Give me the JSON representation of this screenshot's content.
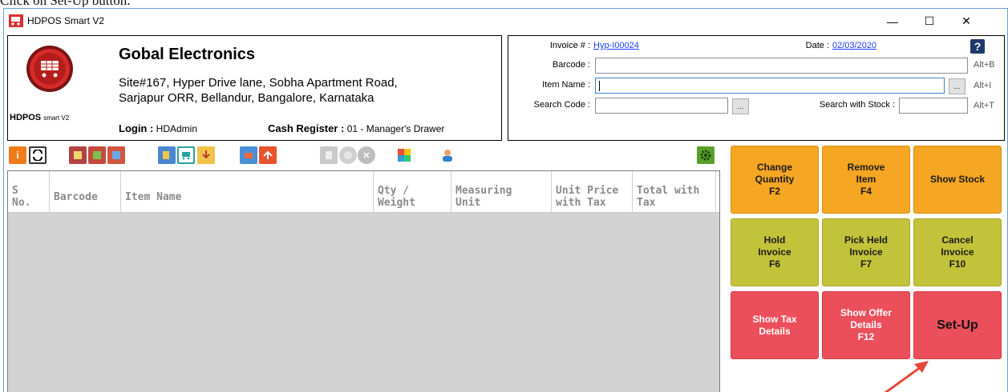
{
  "document": {
    "caption": "Click on Set-Up button."
  },
  "window": {
    "title": "HDPOS Smart V2",
    "minimize_glyph": "—",
    "maximize_glyph": "☐",
    "close_glyph": "✕"
  },
  "store": {
    "name": "Gobal Electronics",
    "address_line1": "Site#167, Hyper Drive lane, Sobha Apartment Road,",
    "address_line2": "Sarjapur ORR, Bellandur, Bangalore, Karnataka",
    "logo_caption": "HDPOS",
    "logo_caption_small": "smart V2",
    "login_label": "Login :",
    "login_value": "HDAdmin",
    "cash_label": "Cash Register :",
    "cash_value": "01 - Manager's Drawer"
  },
  "invoice": {
    "invoice_label": "Invoice # :",
    "invoice_number": "Hyp-I00024",
    "date_label": "Date :",
    "date_value": "02/03/2020",
    "help_glyph": "?",
    "barcode_label": "Barcode :",
    "barcode_hotkey": "Alt+B",
    "item_name_label": "Item Name :",
    "item_name_hotkey": "Alt+I",
    "search_code_label": "Search Code :",
    "search_stock_label": "Search with Stock :",
    "search_stock_hotkey": "Alt+T",
    "browse_glyph": "..."
  },
  "table": {
    "headers": [
      {
        "line1": "S",
        "line2": "No."
      },
      {
        "line1": "Barcode",
        "line2": ""
      },
      {
        "line1": "Item Name",
        "line2": ""
      },
      {
        "line1": "Qty /",
        "line2": "Weight"
      },
      {
        "line1": "Measuring",
        "line2": "Unit"
      },
      {
        "line1": "Unit Price",
        "line2": "with Tax"
      },
      {
        "line1": "Total with",
        "line2": "Tax"
      }
    ]
  },
  "actions": {
    "change_quantity": "Change\nQuantity\nF2",
    "remove_item": "Remove\nItem\nF4",
    "show_stock": "Show Stock",
    "hold_invoice": "Hold\nInvoice\nF6",
    "pick_held_invoice": "Pick Held\nInvoice\nF7",
    "cancel_invoice": "Cancel\nInvoice\nF10",
    "show_tax_details": "Show Tax\nDetails",
    "show_offer_details": "Show Offer\nDetails\nF12",
    "setup": "Set-Up"
  },
  "colors": {
    "orange": "#f5a623",
    "olive": "#c3c33b",
    "red": "#ec4f5c",
    "link": "#1a3cff",
    "arrow": "#e8473a"
  }
}
